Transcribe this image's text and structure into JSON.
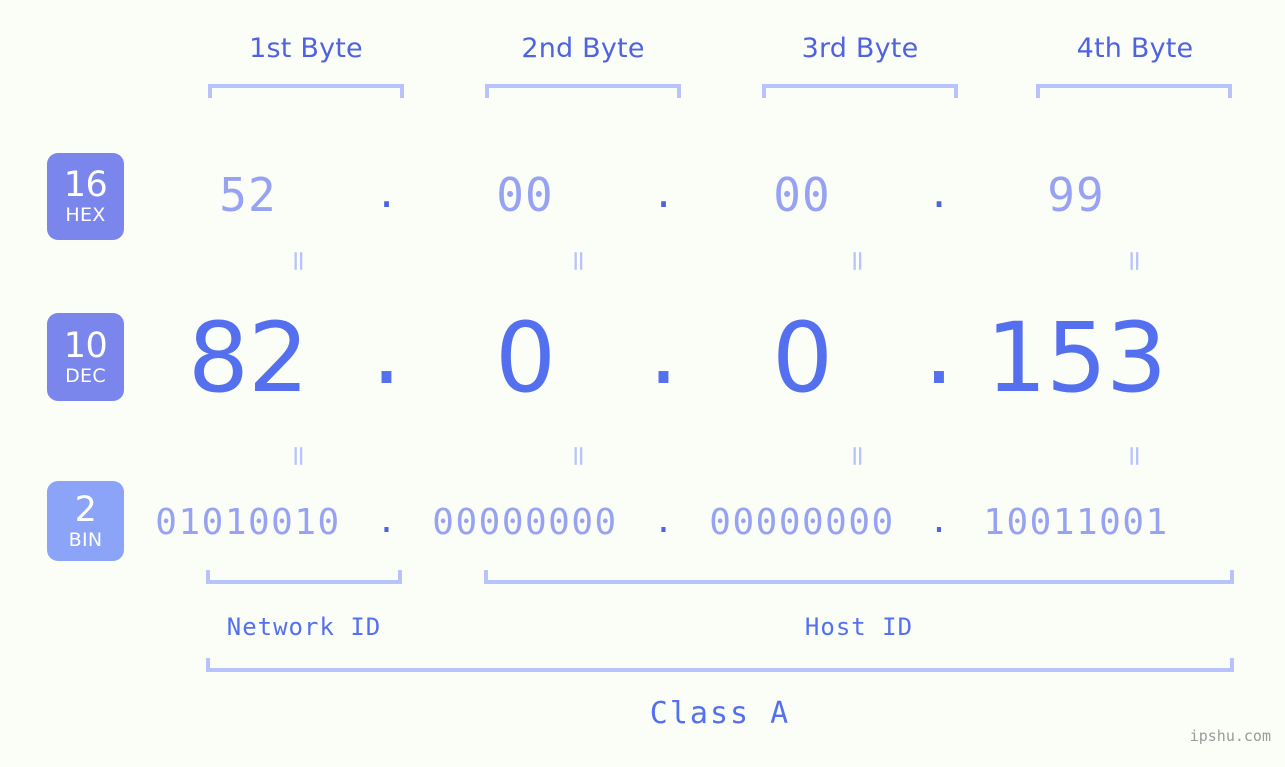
{
  "watermark": "ipshu.com",
  "byte_headers": [
    {
      "label": "1st Byte"
    },
    {
      "label": "2nd Byte"
    },
    {
      "label": "3rd Byte"
    },
    {
      "label": "4th Byte"
    }
  ],
  "bases": [
    {
      "number": "16",
      "name": "HEX",
      "color": "#7b86ec"
    },
    {
      "number": "10",
      "name": "DEC",
      "color": "#7b86ec"
    },
    {
      "number": "2",
      "name": "BIN",
      "color": "#8ba4f7"
    }
  ],
  "separator": ".",
  "equality_mark": "=",
  "rows": {
    "hex": {
      "octets": [
        "52",
        "00",
        "00",
        "99"
      ]
    },
    "dec": {
      "octets": [
        "82",
        "0",
        "0",
        "153"
      ]
    },
    "bin": {
      "octets": [
        "01010010",
        "00000000",
        "00000000",
        "10011001"
      ]
    }
  },
  "sections": {
    "network_id": "Network ID",
    "host_id": "Host ID",
    "class": "Class A"
  },
  "colors": {
    "background": "#fbfdf7",
    "accent_strong": "#4f63e0",
    "accent_mid": "#5470ef",
    "accent_light": "#97a3f2",
    "bracket": "#b9c3fb",
    "badge_dark": "#7b86ec",
    "badge_light": "#8ba4f7",
    "watermark": "#9a9a9a"
  }
}
